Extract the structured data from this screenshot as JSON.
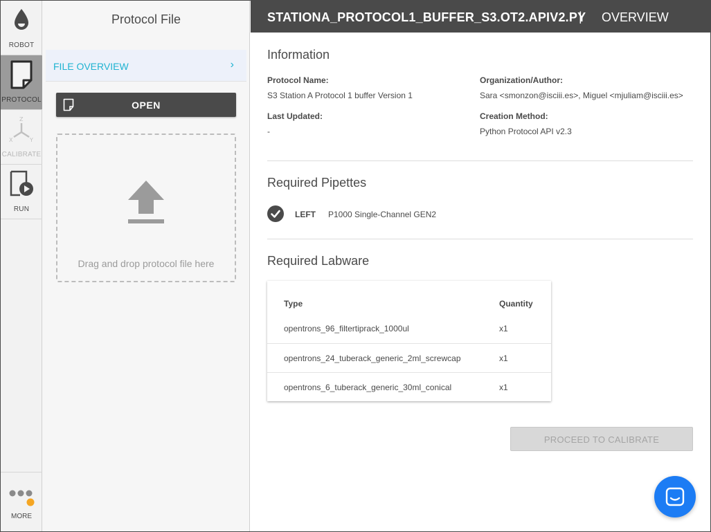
{
  "nav": {
    "items": [
      {
        "label": "ROBOT",
        "icon": "robot-icon",
        "state": "normal"
      },
      {
        "label": "PROTOCOL",
        "icon": "protocol-file-icon",
        "state": "active"
      },
      {
        "label": "CALIBRATE",
        "icon": "calibrate-axes-icon",
        "state": "disabled"
      },
      {
        "label": "RUN",
        "icon": "run-icon",
        "state": "normal"
      }
    ],
    "more": {
      "label": "MORE",
      "icon": "more-dots-icon",
      "badge_color": "#f5a623"
    }
  },
  "panel": {
    "title": "Protocol File",
    "file_overview_label": "FILE OVERVIEW",
    "open_label": "OPEN",
    "dropzone_text": "Drag and drop protocol file here"
  },
  "header": {
    "title": "STATIONA_PROTOCOL1_BUFFER_S3.OT2.APIV2.PY",
    "separator": "|",
    "view": "OVERVIEW"
  },
  "information": {
    "title": "Information",
    "protocol_name_label": "Protocol Name:",
    "protocol_name": "S3 Station A Protocol 1 buffer Version 1",
    "author_label": "Organization/Author:",
    "author": "Sara <smonzon@isciii.es>, Miguel <mjuliam@isciii.es>",
    "last_updated_label": "Last Updated:",
    "last_updated": "-",
    "creation_method_label": "Creation Method:",
    "creation_method": "Python Protocol API v2.3"
  },
  "pipettes": {
    "title": "Required Pipettes",
    "items": [
      {
        "mount": "LEFT",
        "model": "P1000 Single-Channel GEN2"
      }
    ]
  },
  "labware": {
    "title": "Required Labware",
    "col_type": "Type",
    "col_quantity": "Quantity",
    "rows": [
      {
        "type": "opentrons_96_filtertiprack_1000ul",
        "quantity": "x1"
      },
      {
        "type": "opentrons_24_tuberack_generic_2ml_screwcap",
        "quantity": "x1"
      },
      {
        "type": "opentrons_6_tuberack_generic_30ml_conical",
        "quantity": "x1"
      }
    ]
  },
  "proceed_label": "PROCEED TO CALIBRATE",
  "colors": {
    "accent": "#1fb3d1",
    "dark": "#4a4a4a",
    "chat": "#1c7cf4",
    "badge": "#f5a623"
  }
}
